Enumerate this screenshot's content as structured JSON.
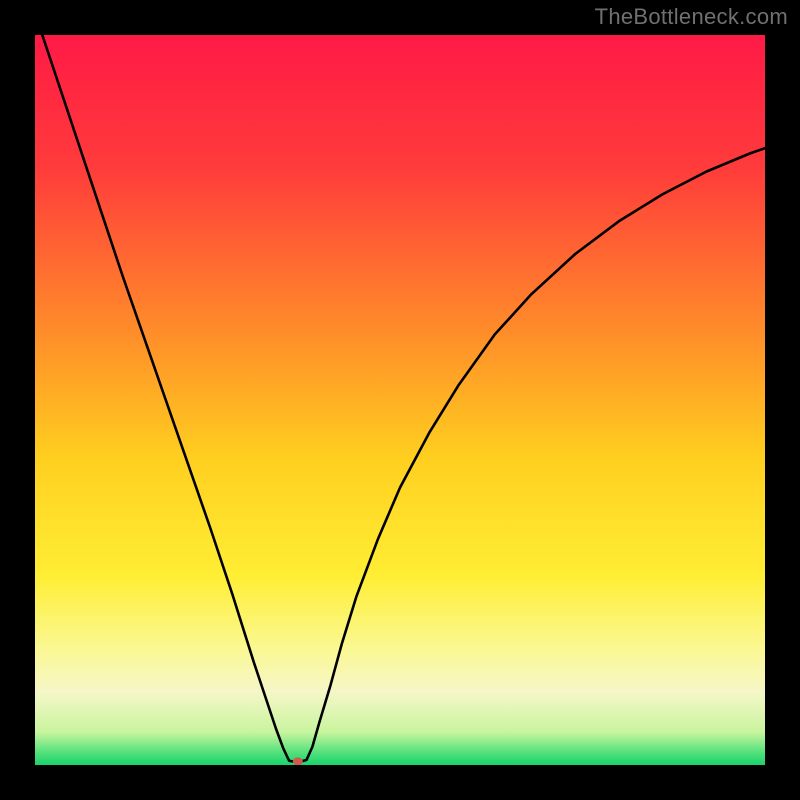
{
  "watermark": "TheBottleneck.com",
  "chart_data": {
    "type": "line",
    "title": "",
    "xlabel": "",
    "ylabel": "",
    "xlim": [
      0,
      100
    ],
    "ylim": [
      0,
      100
    ],
    "gradient_stops": [
      {
        "offset": 0.0,
        "color": "#ff1a46"
      },
      {
        "offset": 0.18,
        "color": "#ff3b3b"
      },
      {
        "offset": 0.4,
        "color": "#ff8a2a"
      },
      {
        "offset": 0.58,
        "color": "#ffcf1f"
      },
      {
        "offset": 0.74,
        "color": "#ffee33"
      },
      {
        "offset": 0.84,
        "color": "#faf892"
      },
      {
        "offset": 0.9,
        "color": "#f6f6c8"
      },
      {
        "offset": 0.955,
        "color": "#c8f59e"
      },
      {
        "offset": 0.985,
        "color": "#4bdf7a"
      },
      {
        "offset": 1.0,
        "color": "#18d36c"
      }
    ],
    "series": [
      {
        "name": "curve",
        "color": "#000000",
        "x": [
          1,
          4,
          8,
          12,
          16,
          20,
          24,
          27,
          30,
          31.5,
          33,
          34,
          34.8,
          35.2,
          36.5,
          37.2,
          38,
          39,
          40.5,
          42,
          44,
          47,
          50,
          54,
          58,
          63,
          68,
          74,
          80,
          86,
          92,
          98,
          100
        ],
        "y": [
          100,
          91,
          79,
          67,
          55.5,
          44,
          32.5,
          23.5,
          14,
          9.5,
          5,
          2.3,
          0.6,
          0.5,
          0.5,
          0.7,
          2.5,
          6,
          11,
          16.5,
          23,
          31,
          38,
          45.5,
          52,
          59,
          64.5,
          70,
          74.5,
          78.2,
          81.3,
          83.8,
          84.5
        ]
      }
    ],
    "marker": {
      "x": 36,
      "y": 0.5,
      "color": "#cf5a4e",
      "rx": 5,
      "ry": 4
    }
  }
}
